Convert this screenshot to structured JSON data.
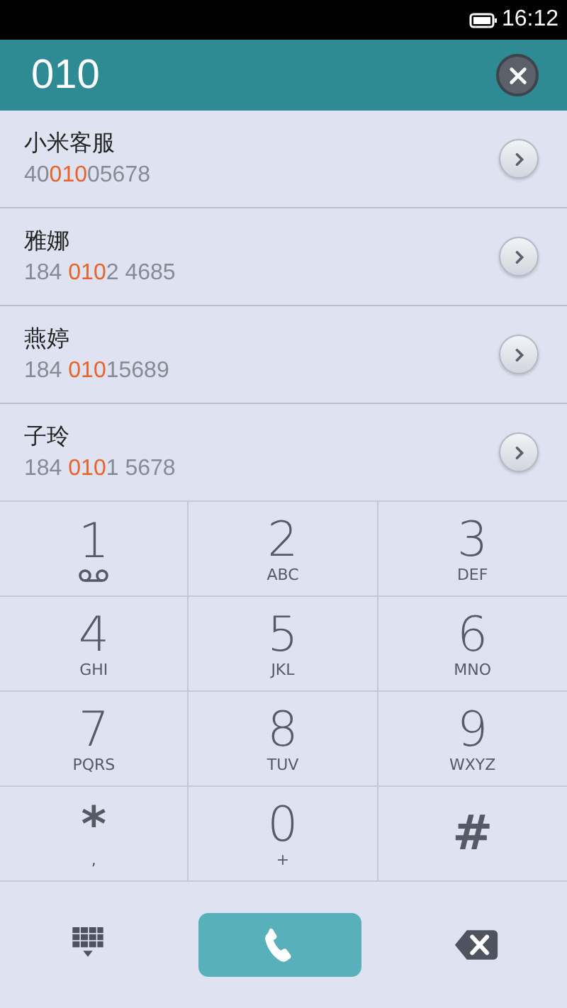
{
  "status_bar": {
    "time": "16:12"
  },
  "search": {
    "value": "010"
  },
  "results": [
    {
      "name": "小米客服",
      "number": {
        "before": "40",
        "match": "010",
        "after": "05678"
      }
    },
    {
      "name": "雅娜",
      "number": {
        "before": "184 ",
        "match": "010",
        "after": "2 4685"
      }
    },
    {
      "name": "燕婷",
      "number": {
        "before": "184 ",
        "match": "010",
        "after": "15689"
      }
    },
    {
      "name": "子玲",
      "number": {
        "before": "184 ",
        "match": "010",
        "after": "1 5678"
      }
    }
  ],
  "keypad": [
    {
      "digit": "1",
      "kind": "voicemail"
    },
    {
      "digit": "2",
      "kind": "letters",
      "letters": "ABC"
    },
    {
      "digit": "3",
      "kind": "letters",
      "letters": "DEF"
    },
    {
      "digit": "4",
      "kind": "letters",
      "letters": "GHI"
    },
    {
      "digit": "5",
      "kind": "letters",
      "letters": "JKL"
    },
    {
      "digit": "6",
      "kind": "letters",
      "letters": "MNO"
    },
    {
      "digit": "7",
      "kind": "letters",
      "letters": "PQRS"
    },
    {
      "digit": "8",
      "kind": "letters",
      "letters": "TUV"
    },
    {
      "digit": "9",
      "kind": "letters",
      "letters": "WXYZ"
    },
    {
      "digit": "*",
      "kind": "letters",
      "letters": ","
    },
    {
      "digit": "0",
      "kind": "letters",
      "letters": "+"
    },
    {
      "digit": "#",
      "kind": "plain"
    }
  ]
}
